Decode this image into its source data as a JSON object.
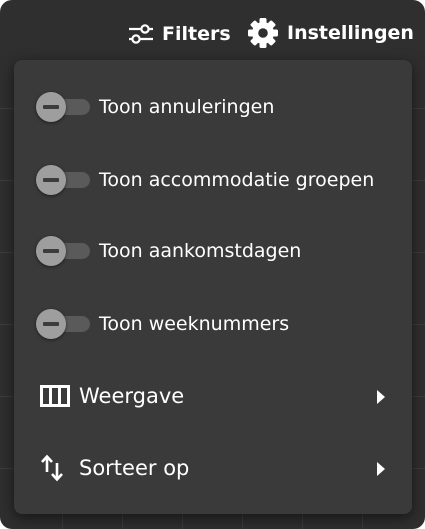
{
  "topbar": {
    "filters_label": "Filters",
    "filters_icon": "sliders-icon",
    "settings_label": "Instellingen",
    "settings_icon": "gear-icon"
  },
  "menu": {
    "toggles": [
      {
        "label": "Toon annuleringen",
        "checked": false
      },
      {
        "label": "Toon accommodatie groepen",
        "checked": false
      },
      {
        "label": "Toon aankomstdagen",
        "checked": false
      },
      {
        "label": "Toon weeknummers",
        "checked": false
      }
    ],
    "submenus": [
      {
        "label": "Weergave",
        "icon": "columns-icon"
      },
      {
        "label": "Sorteer op",
        "icon": "sort-icon"
      }
    ]
  },
  "colors": {
    "background": "#2f2f2f",
    "menu": "#3a3a3a",
    "text": "#ffffff",
    "toggle_knob": "#9e9e9e",
    "toggle_track": "#5a5a5a"
  }
}
